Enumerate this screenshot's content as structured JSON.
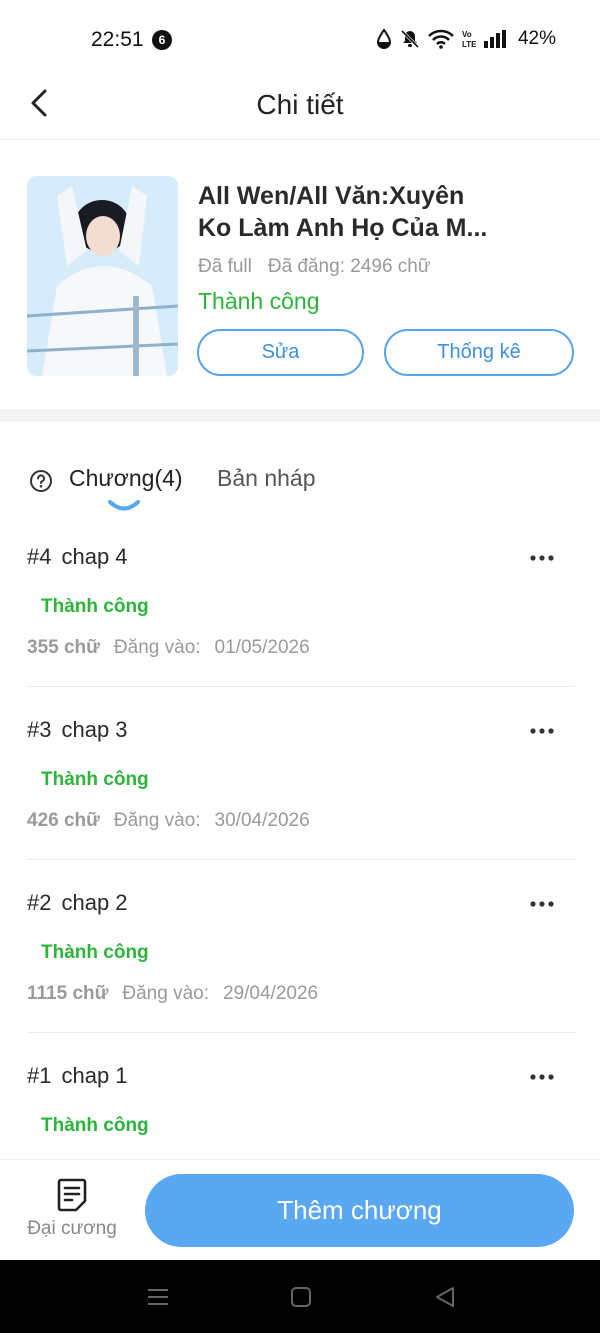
{
  "status_bar": {
    "time": "22:51",
    "notification_count": "6",
    "battery": "42%",
    "icons": [
      "data-saver-icon",
      "mute-icon",
      "wifi-icon",
      "volte-icon",
      "signal-icon"
    ]
  },
  "header": {
    "title": "Chi tiết",
    "back_icon": "back-chevron-icon"
  },
  "book": {
    "title_line1": "All Wen/All Văn:Xuyên",
    "title_line2": "Ko Làm Anh Họ Của M...",
    "state": "Đã full",
    "posted": "Đã đăng: 2496 chữ",
    "status": "Thành công",
    "edit_label": "Sửa",
    "stats_label": "Thống kê"
  },
  "tabs": {
    "chapters_label": "Chương(4)",
    "drafts_label": "Bản nháp"
  },
  "chapters": [
    {
      "num": "#4",
      "title": "chap 4",
      "status": "Thành công",
      "words": "355 chữ",
      "date_label": "Đăng vào:",
      "date": "01/05/2026"
    },
    {
      "num": "#3",
      "title": "chap 3",
      "status": "Thành công",
      "words": "426 chữ",
      "date_label": "Đăng vào:",
      "date": "30/04/2026"
    },
    {
      "num": "#2",
      "title": "chap 2",
      "status": "Thành công",
      "words": "1115 chữ",
      "date_label": "Đăng vào:",
      "date": "29/04/2026"
    },
    {
      "num": "#1",
      "title": "chap 1",
      "status": "Thành công",
      "words": "",
      "date_label": "",
      "date": ""
    }
  ],
  "bottom_bar": {
    "outline_label": "Đại cương",
    "add_chapter_label": "Thêm chương"
  },
  "colors": {
    "accent_blue": "#5aa8f2",
    "success_green": "#2cb53a",
    "muted_gray": "#9a9a9a"
  }
}
